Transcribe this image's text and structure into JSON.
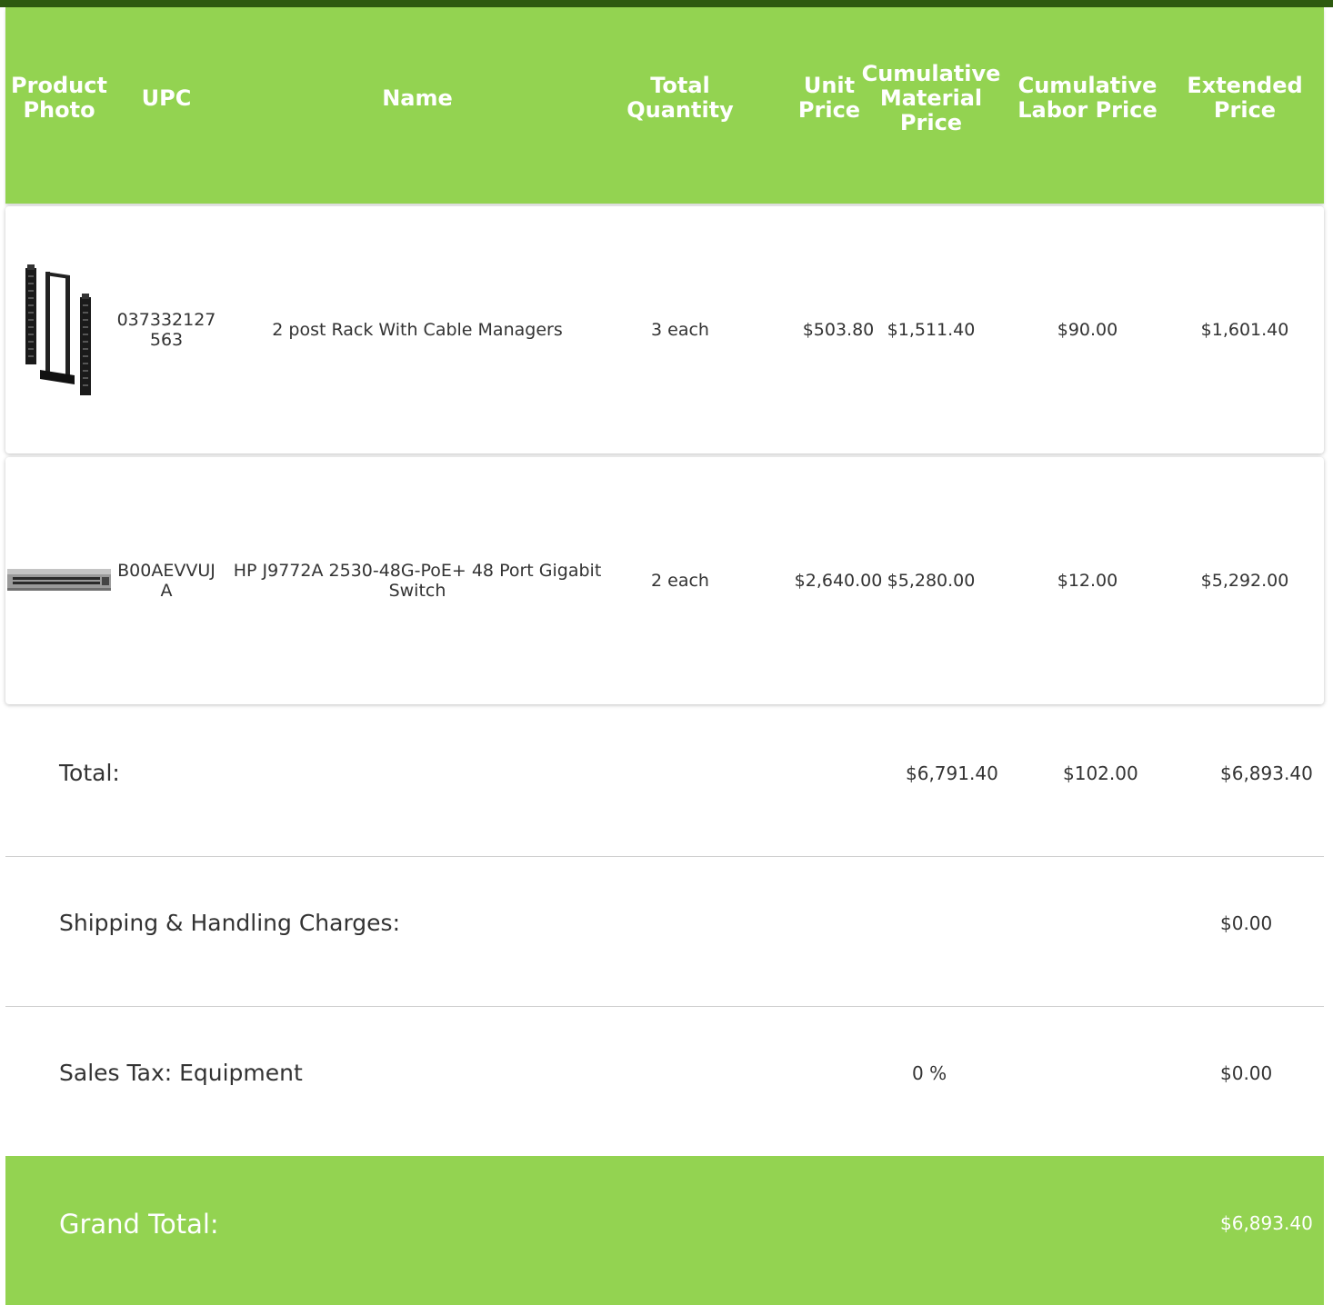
{
  "columns": {
    "photo": "Product Photo",
    "upc": "UPC",
    "name": "Name",
    "quantity": "Total Quantity",
    "unit_price": "Unit Price",
    "material": "Cumulative Material Price",
    "labor": "Cumulative Labor Price",
    "extended": "Extended Price"
  },
  "items": [
    {
      "photo_icon": "rack-icon",
      "upc": "037332127563",
      "name": "2 post Rack With Cable Managers",
      "quantity": "3 each",
      "unit_price": "$503.80",
      "material": "$1,511.40",
      "labor": "$90.00",
      "extended": "$1,601.40"
    },
    {
      "photo_icon": "network-switch-icon",
      "upc": "B00AEVVUJA",
      "name": "HP J9772A 2530-48G-PoE+ 48 Port Gigabit Switch",
      "quantity": "2 each",
      "unit_price": "$2,640.00",
      "material": "$5,280.00",
      "labor": "$12.00",
      "extended": "$5,292.00"
    }
  ],
  "summary": {
    "total_label": "Total:",
    "total_material": "$6,791.40",
    "total_labor": "$102.00",
    "total_extended": "$6,893.40",
    "shipping_label": "Shipping & Handling Charges:",
    "shipping_value": "$0.00",
    "tax_label": "Sales Tax: Equipment",
    "tax_rate": "0 %",
    "tax_value": "$0.00",
    "grand_label": "Grand Total:",
    "grand_value": "$6,893.40"
  },
  "colors": {
    "accent_green": "#93d351",
    "top_bar": "#2d5a0f"
  }
}
